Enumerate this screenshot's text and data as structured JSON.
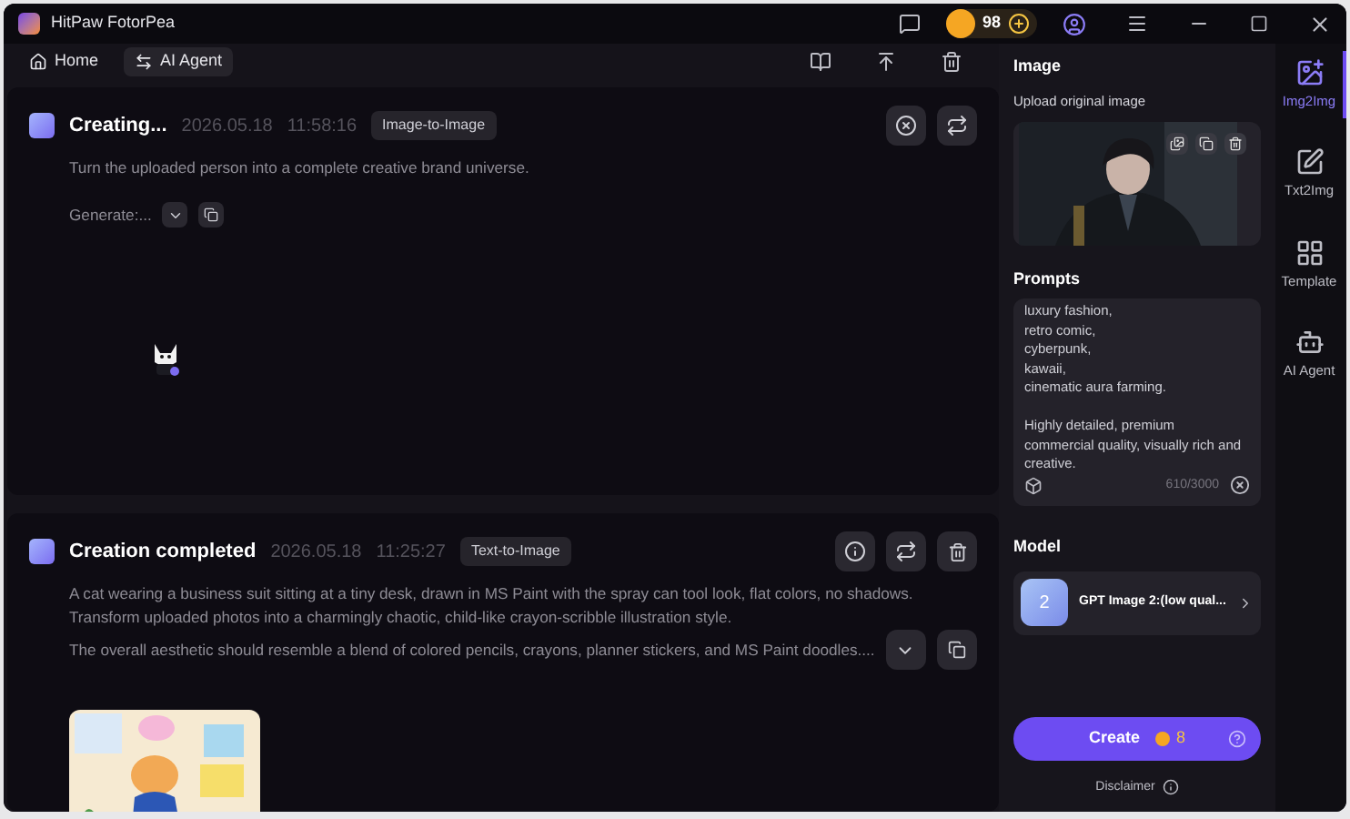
{
  "window": {
    "title": "HitPaw FotorPea",
    "coins": "98"
  },
  "toolbar": {
    "tabs": [
      {
        "label": "Home",
        "selected": false,
        "kind": "home"
      },
      {
        "label": "AI Agent",
        "selected": true,
        "kind": "agent"
      }
    ]
  },
  "tasks": [
    {
      "kind": "creating",
      "title": "Creating...",
      "date": "2026.05.18",
      "time": "11:58:16",
      "tag": "Image-to-Image",
      "prompt": [
        "Turn the uploaded person into a complete creative brand universe."
      ],
      "status": "Generate:..."
    },
    {
      "kind": "completed",
      "title": "Creation completed",
      "date": "2026.05.18",
      "time": "11:25:27",
      "tag": "Text-to-Image",
      "prompt": [
        "A cat wearing a business suit sitting at a tiny desk, drawn in MS Paint with the spray can tool look, flat colors, no shadows.",
        "Transform uploaded photos into a charmingly chaotic, child-like crayon-scribble illustration style.",
        "The overall aesthetic should resemble a blend of colored pencils, crayons, planner stickers, and MS Paint doodles...."
      ]
    }
  ],
  "panel": {
    "image_heading": "Image",
    "upload_label": "Upload original image",
    "prompts_heading": "Prompts",
    "prompt_paragraphs": [
      "luxury fashion,\nretro comic,\ncyberpunk,\nkawaii,\ncinematic aura farming.",
      "Highly detailed, premium\ncommercial quality, visually rich and\ncreative."
    ],
    "counter": "610/3000",
    "model_heading": "Model",
    "model_thumb": "2",
    "model_name": "GPT Image 2:(low qual...",
    "create": "Create",
    "create_cost": "8",
    "disclaimer": "Disclaimer"
  },
  "sidebar": [
    {
      "label": "Img2Img",
      "selected": true,
      "kind": "img2img"
    },
    {
      "label": "Txt2Img",
      "selected": false,
      "kind": "txt2img"
    },
    {
      "label": "Template",
      "selected": false,
      "kind": "template"
    },
    {
      "label": "AI Agent",
      "selected": false,
      "kind": "agent"
    }
  ]
}
